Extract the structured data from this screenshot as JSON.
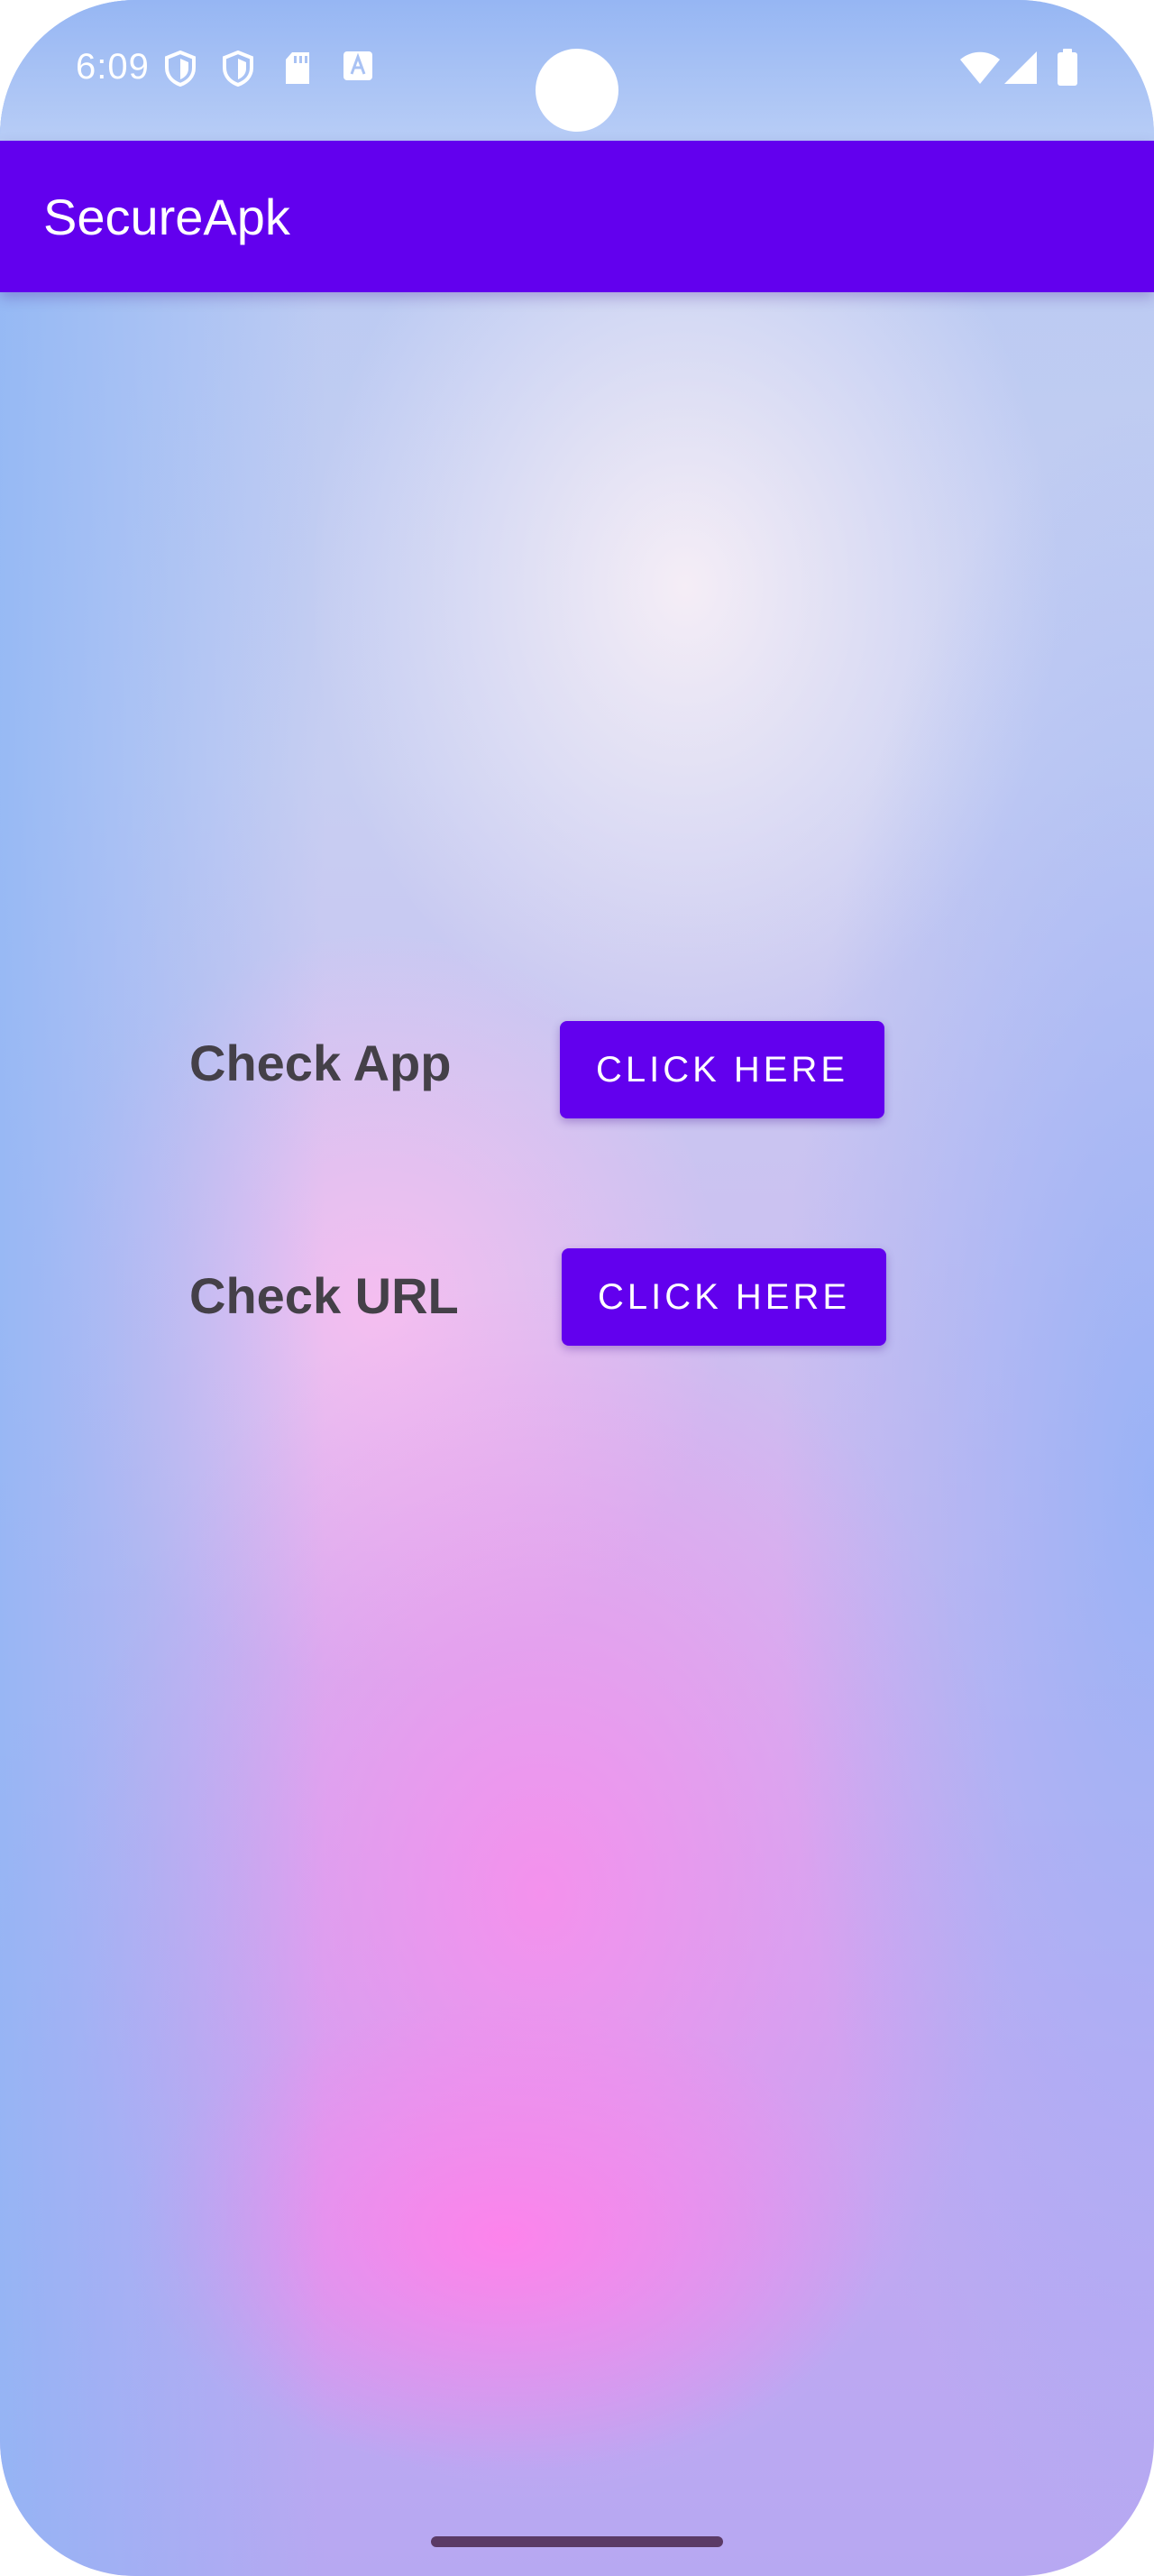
{
  "status_bar": {
    "time": "6:09",
    "left_icons": [
      "shield-icon",
      "shield-icon",
      "sd-card-icon",
      "keyboard-a-icon"
    ],
    "right_icons": [
      "wifi-icon",
      "cell-signal-icon",
      "battery-icon"
    ]
  },
  "app_bar": {
    "title": "SecureApk",
    "color": "#6200ee"
  },
  "main": {
    "rows": [
      {
        "label": "Check App",
        "button_label": "CLICK HERE"
      },
      {
        "label": "Check URL",
        "button_label": "CLICK HERE"
      }
    ]
  },
  "colors": {
    "accent": "#6200ee",
    "label_text": "#444048"
  }
}
